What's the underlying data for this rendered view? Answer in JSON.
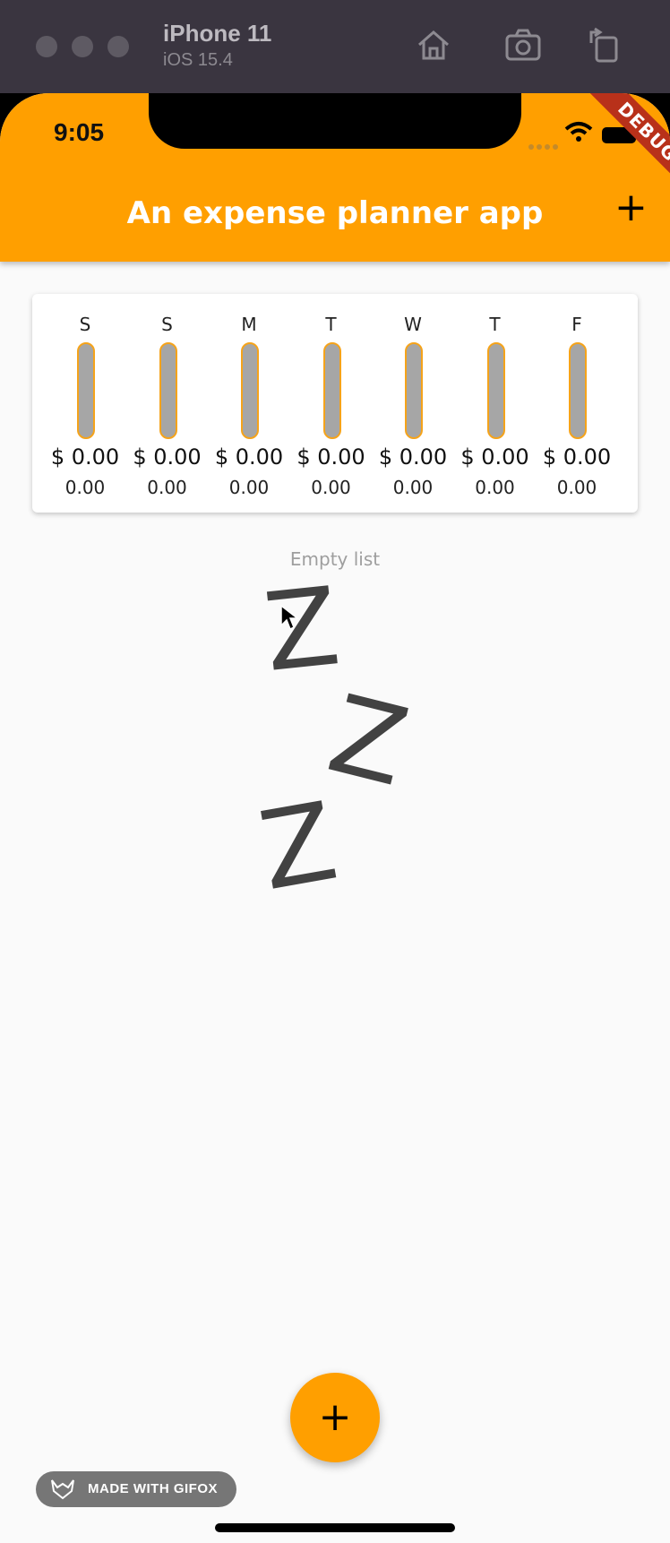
{
  "simulator": {
    "device_name": "iPhone 11",
    "os_version": "iOS 15.4"
  },
  "status_bar": {
    "time": "9:05"
  },
  "debug_banner": "DEBUG",
  "app_bar": {
    "title": "An expense planner app",
    "add_label": "+"
  },
  "chart": {
    "days": [
      {
        "day": "S",
        "amount": "$ 0.00",
        "percent": "0.00",
        "fill": 0
      },
      {
        "day": "S",
        "amount": "$ 0.00",
        "percent": "0.00",
        "fill": 0
      },
      {
        "day": "M",
        "amount": "$ 0.00",
        "percent": "0.00",
        "fill": 0
      },
      {
        "day": "T",
        "amount": "$ 0.00",
        "percent": "0.00",
        "fill": 0
      },
      {
        "day": "W",
        "amount": "$ 0.00",
        "percent": "0.00",
        "fill": 0
      },
      {
        "day": "T",
        "amount": "$ 0.00",
        "percent": "0.00",
        "fill": 0
      },
      {
        "day": "F",
        "amount": "$ 0.00",
        "percent": "0.00",
        "fill": 0
      }
    ]
  },
  "empty_state": {
    "label": "Empty list",
    "z": "Z"
  },
  "fab": {
    "label": "+"
  },
  "watermark": {
    "text": "MADE WITH GIFOX"
  },
  "colors": {
    "accent": "#ff9f00",
    "bar_track": "#a6a6a6",
    "debug": "#b8311a"
  }
}
